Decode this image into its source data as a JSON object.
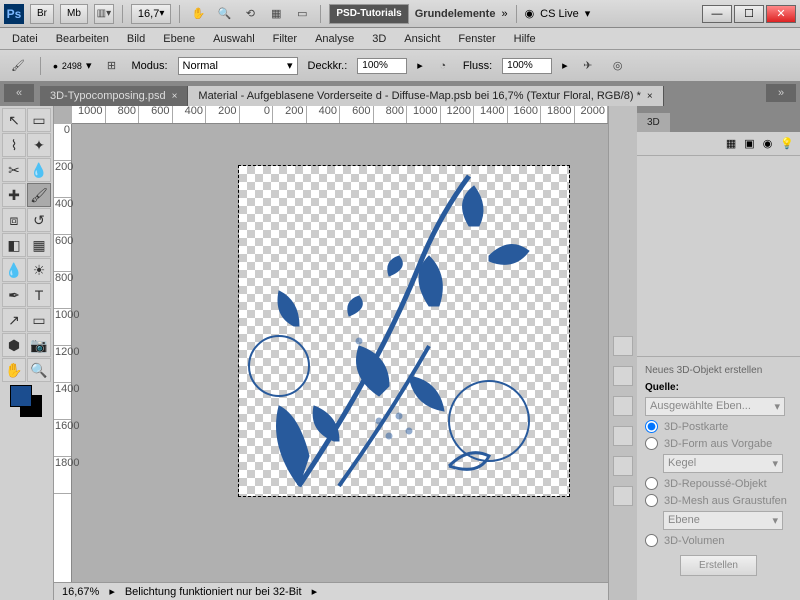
{
  "app": {
    "logo": "Ps",
    "zoom": "16,7",
    "cslive": "CS Live",
    "workspace1": "PSD-Tutorials",
    "workspace2": "Grundelemente",
    "br": "Br",
    "mb": "Mb"
  },
  "menu": {
    "datei": "Datei",
    "bearbeiten": "Bearbeiten",
    "bild": "Bild",
    "ebene": "Ebene",
    "auswahl": "Auswahl",
    "filter": "Filter",
    "analyse": "Analyse",
    "d3d": "3D",
    "ansicht": "Ansicht",
    "fenster": "Fenster",
    "hilfe": "Hilfe"
  },
  "options": {
    "brushsize": "2498",
    "modus_label": "Modus:",
    "modus_value": "Normal",
    "deckkr_label": "Deckkr.:",
    "deckkr_value": "100%",
    "fluss_label": "Fluss:",
    "fluss_value": "100%"
  },
  "tabs": {
    "t1": "3D-Typocomposing.psd",
    "t2": "Material - Aufgeblasene Vorderseite d - Diffuse-Map.psb bei 16,7% (Textur Floral, RGB/8) *"
  },
  "ruler_top": [
    "1000",
    "800",
    "600",
    "400",
    "200",
    "0",
    "200",
    "400",
    "600",
    "800",
    "1000",
    "1200",
    "1400",
    "1600",
    "1800",
    "2000"
  ],
  "ruler_left": [
    "0",
    "200",
    "400",
    "600",
    "800",
    "1000",
    "1200",
    "1400",
    "1600",
    "1800"
  ],
  "status": {
    "zoom": "16,67%",
    "msg": "Belichtung funktioniert nur bei 32-Bit"
  },
  "panel": {
    "tab": "3D",
    "section_title": "Neues 3D-Objekt erstellen",
    "quelle": "Quelle:",
    "quelle_value": "Ausgewählte Eben...",
    "r1": "3D-Postkarte",
    "r2": "3D-Form aus Vorgabe",
    "shape": "Kegel",
    "r3": "3D-Repoussé-Objekt",
    "r4": "3D-Mesh aus Graustufen",
    "mesh": "Ebene",
    "r5": "3D-Volumen",
    "create": "Erstellen"
  }
}
